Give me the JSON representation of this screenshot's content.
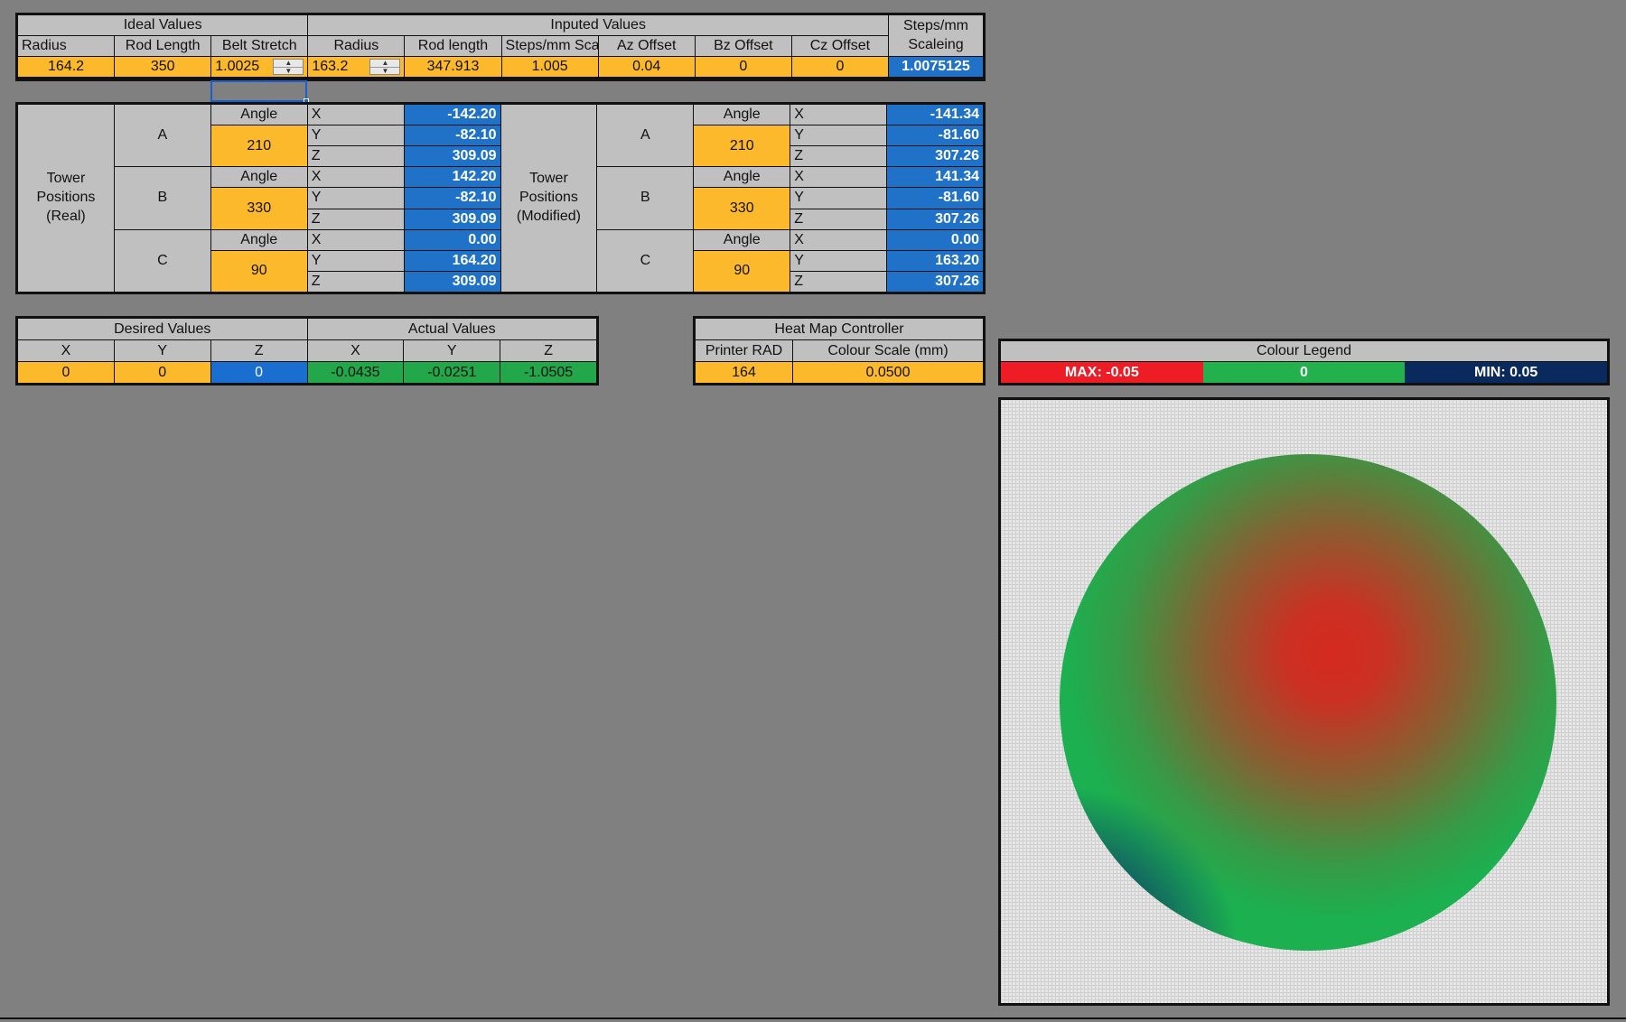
{
  "calibration": {
    "ideal_header": "Ideal Values",
    "inputed_header": "Inputed Values",
    "steps_header": "Steps/mm Scaleing",
    "columns": [
      "Radius",
      "Rod Length",
      "Belt Stretch",
      "Radius",
      "Rod length",
      "Steps/mm Sca",
      "Az Offset",
      "Bz Offset",
      "Cz Offset"
    ],
    "values": {
      "ideal_radius": "164.2",
      "ideal_rod_length": "350",
      "belt_stretch": "1.0025",
      "input_radius": "163.2",
      "input_rod_length": "347.913",
      "steps_scale": "1.005",
      "az_offset": "0.04",
      "bz_offset": "0",
      "cz_offset": "0",
      "steps_result": "1.0075125"
    }
  },
  "towers": {
    "real_label": "Tower Positions (Real)",
    "modified_label": "Tower Positions (Modified)",
    "angle_label": "Angle",
    "axis_labels": [
      "X",
      "Y",
      "Z"
    ],
    "real": [
      {
        "name": "A",
        "angle": "210",
        "x": "-142.20",
        "y": "-82.10",
        "z": "309.09"
      },
      {
        "name": "B",
        "angle": "330",
        "x": "142.20",
        "y": "-82.10",
        "z": "309.09"
      },
      {
        "name": "C",
        "angle": "90",
        "x": "0.00",
        "y": "164.20",
        "z": "309.09"
      }
    ],
    "modified": [
      {
        "name": "A",
        "angle": "210",
        "x": "-141.34",
        "y": "-81.60",
        "z": "307.26"
      },
      {
        "name": "B",
        "angle": "330",
        "x": "141.34",
        "y": "-81.60",
        "z": "307.26"
      },
      {
        "name": "C",
        "angle": "90",
        "x": "0.00",
        "y": "163.20",
        "z": "307.26"
      }
    ]
  },
  "desired": {
    "header": "Desired Values",
    "labels": [
      "X",
      "Y",
      "Z"
    ],
    "values": [
      "0",
      "0",
      "0"
    ]
  },
  "actual": {
    "header": "Actual Values",
    "labels": [
      "X",
      "Y",
      "Z"
    ],
    "values": [
      "-0.0435",
      "-0.0251",
      "-1.0505"
    ]
  },
  "heatmap_controller": {
    "header": "Heat Map Controller",
    "printer_rad_label": "Printer RAD",
    "colour_scale_label": "Colour Scale (mm)",
    "printer_rad": "164",
    "colour_scale": "0.0500"
  },
  "legend": {
    "title": "Colour Legend",
    "max_label": "MAX: -0.05",
    "mid_label": "0",
    "min_label": "MIN: 0.05",
    "colors": {
      "max": "#ee1c25",
      "mid": "#22b14c",
      "min": "#0a2a5e"
    }
  },
  "heatmap": {
    "colors": {
      "high": "#d42a20",
      "zero": "#1cb050",
      "low": "#0c3a6a",
      "background": "#e6e6e6"
    }
  }
}
